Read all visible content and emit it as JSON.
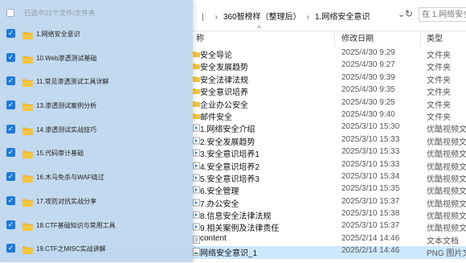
{
  "explorer": {
    "breadcrumb": [
      "360智榜样（整理后）",
      "1.网络安全意识"
    ],
    "search_placeholder": "在 1.网络安全",
    "columns": {
      "name": "称",
      "modified": "修改日期",
      "type": "类型"
    },
    "files": [
      {
        "name": "安全导论",
        "date": "2025/4/30 9:29",
        "type": "文件夹",
        "kind": "folder"
      },
      {
        "name": "安全发展趋势",
        "date": "2025/4/30 9:27",
        "type": "文件夹",
        "kind": "folder"
      },
      {
        "name": "安全法律法规",
        "date": "2025/4/30 9:39",
        "type": "文件夹",
        "kind": "folder"
      },
      {
        "name": "安全意识培养",
        "date": "2025/4/30 9:35",
        "type": "文件夹",
        "kind": "folder"
      },
      {
        "name": "企业办公安全",
        "date": "2025/4/30 9:25",
        "type": "文件夹",
        "kind": "folder"
      },
      {
        "name": "邮件安全",
        "date": "2025/4/30 9:40",
        "type": "文件夹",
        "kind": "folder"
      },
      {
        "name": "1.网络安全介绍",
        "date": "2025/3/10 15:30",
        "type": "优酷视频文件",
        "kind": "video"
      },
      {
        "name": "2.安全发展趋势",
        "date": "2025/3/10 15:33",
        "type": "优酷视频文件",
        "kind": "video"
      },
      {
        "name": "3.安全意识培养1",
        "date": "2025/3/10 15:33",
        "type": "优酷视频文件",
        "kind": "video"
      },
      {
        "name": "4.安全意识培养2",
        "date": "2025/3/10 15:33",
        "type": "优酷视频文件",
        "kind": "video"
      },
      {
        "name": "5.安全意识培养3",
        "date": "2025/3/10 15:34",
        "type": "优酷视频文件",
        "kind": "video"
      },
      {
        "name": "6.安全管理",
        "date": "2025/3/10 15:35",
        "type": "优酷视频文件",
        "kind": "video"
      },
      {
        "name": "7.办公安全",
        "date": "2025/3/10 15:37",
        "type": "优酷视频文件",
        "kind": "video"
      },
      {
        "name": "8.信息安全法律法规",
        "date": "2025/3/10 15:38",
        "type": "优酷视频文件",
        "kind": "video"
      },
      {
        "name": "9.相关案例及法律责任",
        "date": "2025/3/10 15:37",
        "type": "优酷视频文件",
        "kind": "video"
      },
      {
        "name": "content",
        "date": "2025/2/14 14:46",
        "type": "文本文档",
        "kind": "text"
      },
      {
        "name": "网络安全意识_1",
        "date": "2025/2/14 14:46",
        "type": "PNG 图片文件",
        "kind": "image"
      }
    ]
  },
  "overlay": {
    "header": "已选中21个文件/文件夹",
    "items": [
      "1.网络安全意识",
      "10.Web渗透测试基础",
      "11.常见渗透测试工具详解",
      "13.渗透测试案例分析",
      "14.渗透测试实战技巧",
      "15.代码审计基础",
      "16.木马免杀与WAF绕过",
      "17.攻防对抗实战分享",
      "18.CTF基础知识与常用工具",
      "19.CTF之MISC实战讲解"
    ]
  },
  "colors": {
    "accent": "#1e7ad6",
    "folder": "#f4c542",
    "overlay": "#bed6ee"
  }
}
